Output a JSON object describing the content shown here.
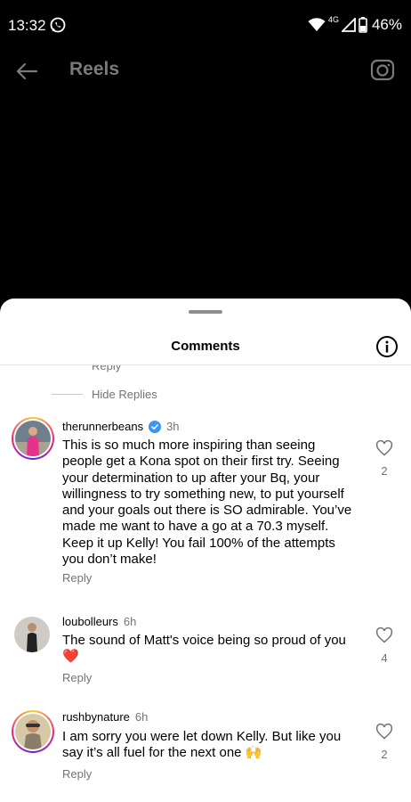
{
  "status_bar": {
    "time": "13:32",
    "network": "4G",
    "battery": "46%"
  },
  "header": {
    "title": "Reels"
  },
  "sheet": {
    "title": "Comments",
    "reply_cut": "Reply",
    "hide_replies": "Hide Replies"
  },
  "comments": [
    {
      "username": "therunnerbeans",
      "verified": true,
      "time": "3h",
      "text": "This is so much more inspiring than seeing people get a Kona spot on their first try. Seeing your determination to up after your Bq, your willingness to try something new, to put yourself and your goals out there is SO admirable. You’ve made me want to have a go at a 70.3 myself. Keep it up Kelly! You fail 100% of the attempts you don’t make!",
      "reply": "Reply",
      "likes": "2"
    },
    {
      "username": "loubolleurs",
      "time": "6h",
      "text": "The sound of Matt's voice being so proud of you",
      "emoji": "❤️",
      "reply": "Reply",
      "likes": "4"
    },
    {
      "username": "rushbynature",
      "time": "6h",
      "text": "I am sorry you were let down Kelly. But like you say it’s all fuel for the next one",
      "emoji": "🙌",
      "reply": "Reply",
      "likes": "2"
    }
  ],
  "colors": {
    "background": "#000000",
    "sheet": "#ffffff",
    "secondary_text": "#737373",
    "verified": "#3897f0"
  }
}
